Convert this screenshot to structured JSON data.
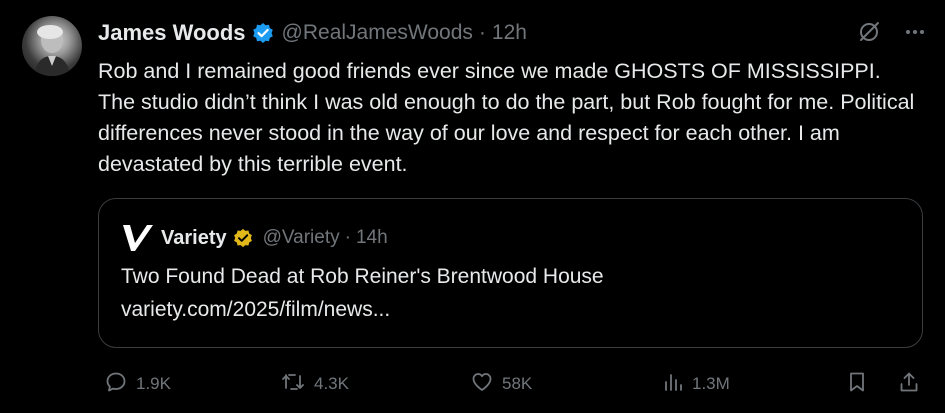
{
  "author": {
    "display_name": "James Woods",
    "handle": "@RealJamesWoods",
    "separator": "·",
    "time": "12h",
    "verified_icon": "verified-badge-icon"
  },
  "tweet": {
    "text": "Rob and I remained good friends ever since we made GHOSTS OF MISSISSIPPI. The studio didn’t think I was old enough to do the part, but Rob fought for me. Political differences never stood in the way of our love and respect for each other. I am devastated by this terrible event."
  },
  "quoted": {
    "display_name": "Variety",
    "handle": "@Variety",
    "separator": "·",
    "time": "14h",
    "title": "Two Found Dead at Rob Reiner's Brentwood House",
    "link": "variety.com/2025/film/news..."
  },
  "metrics": {
    "replies": "1.9K",
    "reposts": "4.3K",
    "likes": "58K",
    "views": "1.3M"
  },
  "icons": {
    "top": [
      "grok-icon",
      "more-icon"
    ],
    "bottom": [
      "reply-icon",
      "repost-icon",
      "like-icon",
      "views-icon",
      "bookmark-icon",
      "share-icon"
    ]
  },
  "colors": {
    "background": "#000000",
    "text_primary": "#e7e9ea",
    "text_secondary": "#71767b",
    "verified_blue": "#1d9bf0",
    "verified_gold": "#e2b719",
    "border": "#3a3d40"
  }
}
